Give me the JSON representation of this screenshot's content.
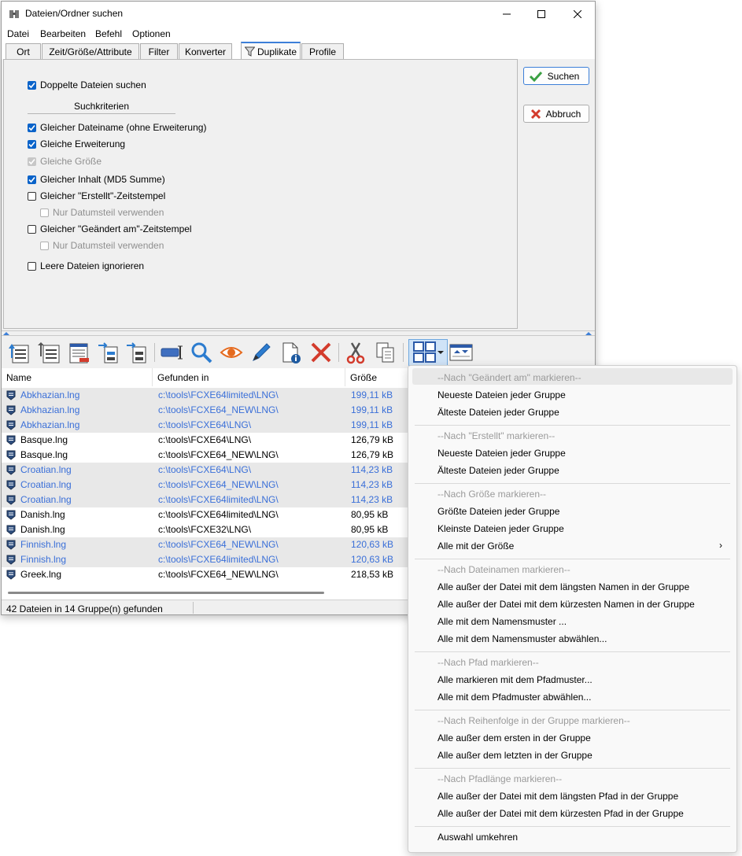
{
  "window": {
    "title": "Dateien/Ordner suchen",
    "menu": [
      "Datei",
      "Bearbeiten",
      "Befehl",
      "Optionen"
    ],
    "tabs": [
      "Ort",
      "Zeit/Größe/Attribute",
      "Filter",
      "Konverter",
      "Duplikate",
      "Profile"
    ],
    "active_tab": "Duplikate"
  },
  "duplicates_panel": {
    "find_duplicates": {
      "label": "Doppelte Dateien suchen",
      "checked": true
    },
    "criteria_title": "Suchkriterien",
    "options": [
      {
        "label": "Gleicher Dateiname (ohne Erweiterung)",
        "checked": true,
        "disabled": false
      },
      {
        "label": "Gleiche Erweiterung",
        "checked": true,
        "disabled": false
      },
      {
        "label": "Gleiche Größe",
        "checked": true,
        "disabled": true
      },
      {
        "label": "Gleicher Inhalt (MD5 Summe)",
        "checked": true,
        "disabled": false
      },
      {
        "label": "Gleicher \"Erstellt\"-Zeitstempel",
        "checked": false,
        "disabled": false
      },
      {
        "label": "Nur Datumsteil verwenden",
        "checked": false,
        "disabled": true
      },
      {
        "label": "Gleicher \"Geändert am\"-Zeitstempel",
        "checked": false,
        "disabled": false
      },
      {
        "label": "Nur Datumsteil verwenden",
        "checked": false,
        "disabled": true
      },
      {
        "label": "Leere Dateien ignorieren",
        "checked": false,
        "disabled": false
      }
    ]
  },
  "buttons": {
    "search": "Suchen",
    "cancel": "Abbruch"
  },
  "results": {
    "columns": [
      "Name",
      "Gefunden in",
      "Größe"
    ],
    "rows": [
      {
        "name": "Abkhazian.lng",
        "path": "c:\\tools\\FCXE64limited\\LNG\\",
        "size": "199,11 kB",
        "selected": true,
        "group_shade": true
      },
      {
        "name": "Abkhazian.lng",
        "path": "c:\\tools\\FCXE64_NEW\\LNG\\",
        "size": "199,11 kB",
        "selected": true,
        "group_shade": true
      },
      {
        "name": "Abkhazian.lng",
        "path": "c:\\tools\\FCXE64\\LNG\\",
        "size": "199,11 kB",
        "selected": true,
        "group_shade": true
      },
      {
        "name": "Basque.lng",
        "path": "c:\\tools\\FCXE64\\LNG\\",
        "size": "126,79 kB",
        "selected": false,
        "group_shade": false
      },
      {
        "name": "Basque.lng",
        "path": "c:\\tools\\FCXE64_NEW\\LNG\\",
        "size": "126,79 kB",
        "selected": false,
        "group_shade": false
      },
      {
        "name": "Croatian.lng",
        "path": "c:\\tools\\FCXE64\\LNG\\",
        "size": "114,23 kB",
        "selected": true,
        "group_shade": true
      },
      {
        "name": "Croatian.lng",
        "path": "c:\\tools\\FCXE64_NEW\\LNG\\",
        "size": "114,23 kB",
        "selected": true,
        "group_shade": true
      },
      {
        "name": "Croatian.lng",
        "path": "c:\\tools\\FCXE64limited\\LNG\\",
        "size": "114,23 kB",
        "selected": true,
        "group_shade": true
      },
      {
        "name": "Danish.lng",
        "path": "c:\\tools\\FCXE64limited\\LNG\\",
        "size": "80,95 kB",
        "selected": false,
        "group_shade": false
      },
      {
        "name": "Danish.lng",
        "path": "c:\\tools\\FCXE32\\LNG\\",
        "size": "80,95 kB",
        "selected": false,
        "group_shade": false
      },
      {
        "name": "Finnish.lng",
        "path": "c:\\tools\\FCXE64_NEW\\LNG\\",
        "size": "120,63 kB",
        "selected": true,
        "group_shade": true
      },
      {
        "name": "Finnish.lng",
        "path": "c:\\tools\\FCXE64limited\\LNG\\",
        "size": "120,63 kB",
        "selected": true,
        "group_shade": true
      },
      {
        "name": "Greek.lng",
        "path": "c:\\tools\\FCXE64_NEW\\LNG\\",
        "size": "218,53 kB",
        "selected": false,
        "group_shade": false
      }
    ]
  },
  "status": "42 Dateien in 14 Gruppe(n) gefunden",
  "toolbar_icons": [
    "list-view-icon",
    "list-up-icon",
    "report-icon",
    "move-to-icon",
    "copy-to-icon",
    "rename-icon",
    "search-icon",
    "view-icon",
    "edit-icon",
    "file-info-icon",
    "delete-icon",
    "cut-icon",
    "copy-icon",
    "mark-groups-icon",
    "dropdown-arrow-icon",
    "collapse-icon"
  ],
  "context_menu": {
    "sections": [
      {
        "header": "--Nach \"Geändert am\" markieren--",
        "items": [
          "Neueste Dateien jeder Gruppe",
          "Älteste Dateien jeder Gruppe"
        ]
      },
      {
        "header": "--Nach \"Erstellt\" markieren--",
        "items": [
          "Neueste Dateien jeder Gruppe",
          "Älteste Dateien jeder Gruppe"
        ]
      },
      {
        "header": "--Nach Größe markieren--",
        "items": [
          "Größte Dateien jeder Gruppe",
          "Kleinste Dateien jeder Gruppe",
          "Alle mit der Größe"
        ]
      },
      {
        "header": "--Nach Dateinamen markieren--",
        "items": [
          "Alle außer der Datei mit dem längsten Namen in der Gruppe",
          "Alle außer der Datei mit dem kürzesten Namen in der Gruppe",
          "Alle mit dem Namensmuster ...",
          "Alle mit dem Namensmuster abwählen..."
        ]
      },
      {
        "header": "--Nach Pfad markieren--",
        "items": [
          "Alle markieren mit dem Pfadmuster...",
          "Alle mit dem Pfadmuster abwählen..."
        ]
      },
      {
        "header": "--Nach Reihenfolge in der Gruppe markieren--",
        "items": [
          "Alle außer dem ersten in der Gruppe",
          "Alle außer dem letzten in der Gruppe"
        ]
      },
      {
        "header": "--Nach Pfadlänge markieren--",
        "items": [
          "Alle außer der Datei mit dem längsten Pfad in der Gruppe",
          "Alle außer der Datei mit dem kürzesten Pfad in der Gruppe"
        ]
      },
      {
        "header": "",
        "items": [
          "Auswahl umkehren"
        ]
      }
    ],
    "submenu_arrow": "›"
  },
  "colors": {
    "accent": "#0a63c9",
    "selected_text": "#3a6fd8",
    "group_shade": "#e8e8e8"
  }
}
